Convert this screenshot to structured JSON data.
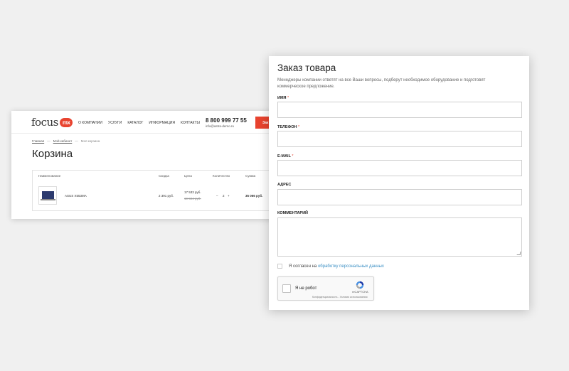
{
  "cart_page": {
    "logo_text": "focus",
    "logo_badge": "mx",
    "nav": [
      "О компании",
      "Услуги",
      "Каталог",
      "Информация",
      "Контакты"
    ],
    "phone": "8 800 999 77 55",
    "email": "info@astra-demo.ru",
    "header_button": "Зак",
    "breadcrumbs": [
      "Главная",
      "Мой кабинет",
      "Моя корзина"
    ],
    "breadcrumb_sep": "—",
    "title": "Корзина",
    "columns": [
      "Наименование",
      "Скидка",
      "Цена",
      "Количество",
      "Сумма"
    ],
    "row": {
      "name": "ASUS X553MA",
      "discount": "2 391 руб.",
      "price": "17 533 руб.",
      "old_price": "19 924 руб.",
      "qty_minus": "–",
      "qty": "2",
      "qty_plus": "+",
      "sum": "35 066 руб."
    }
  },
  "order_form": {
    "title": "Заказ товара",
    "description": "Менеджеры компании ответят на все Ваши вопросы, подберут необходимое оборудование и подготовят коммерческое предложение.",
    "fields": [
      {
        "label": "ИМЯ",
        "required": "*",
        "value": ""
      },
      {
        "label": "ТЕЛЕФОН",
        "required": "*",
        "value": ""
      },
      {
        "label": "E-MAIL",
        "required": "*",
        "value": ""
      },
      {
        "label": "АДРЕС",
        "required": "",
        "value": ""
      },
      {
        "label": "КОММЕНТАРИЙ",
        "required": "",
        "value": ""
      }
    ],
    "consent_text": "Я согласен на",
    "consent_link": "обработку персональных данных",
    "recaptcha": {
      "label": "Я не робот",
      "brand": "reCAPTCHA",
      "links": "Конфиденциальность - Условия использования"
    },
    "colors": {
      "accent": "#e8432f",
      "link": "#3a8fc4"
    }
  }
}
